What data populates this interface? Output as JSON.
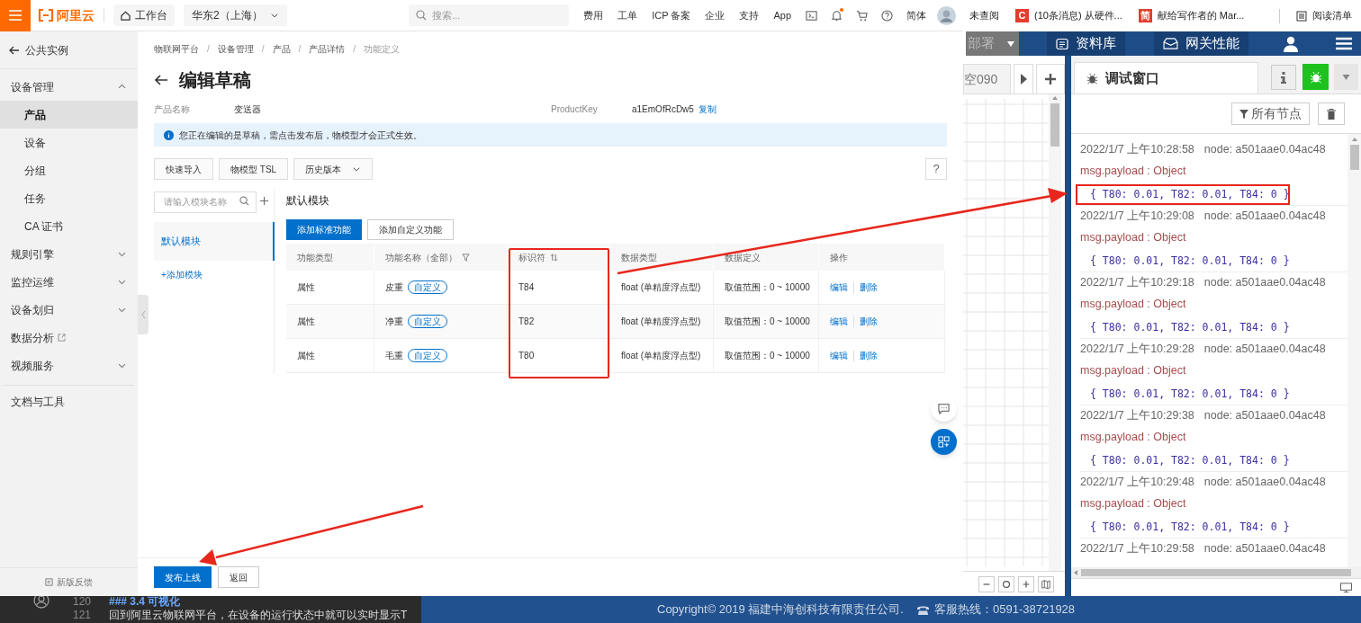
{
  "topbar": {
    "logo": "阿里云",
    "workbench": "工作台",
    "region": "华东2（上海）",
    "search_placeholder": "搜索...",
    "links": [
      "费用",
      "工单",
      "ICP 备案",
      "企业",
      "支持",
      "App"
    ],
    "notification_dot": true,
    "language": "简体"
  },
  "bookmarks": [
    {
      "kind": "plain",
      "label": "未查阅"
    },
    {
      "kind": "favicon",
      "icon_text": "C",
      "label": "(10条消息) 从硬件..."
    },
    {
      "kind": "favicon",
      "icon_text": "简",
      "label": "献给写作者的 Mar..."
    }
  ],
  "reading_list": "阅读清单",
  "sidebar": {
    "back": "公共实例",
    "items": [
      {
        "kind": "group",
        "label": "设备管理",
        "expanded": true,
        "children": [
          {
            "label": "产品",
            "selected": true
          },
          {
            "label": "设备",
            "selected": false
          },
          {
            "label": "分组",
            "selected": false
          },
          {
            "label": "任务",
            "selected": false
          },
          {
            "label": "CA 证书",
            "selected": false
          }
        ]
      },
      {
        "kind": "group",
        "label": "规则引擎",
        "expanded": false
      },
      {
        "kind": "group",
        "label": "监控运维",
        "expanded": false
      },
      {
        "kind": "group",
        "label": "设备划归",
        "expanded": false
      },
      {
        "kind": "external",
        "label": "数据分析"
      },
      {
        "kind": "group",
        "label": "视频服务",
        "expanded": false
      }
    ],
    "docs": "文档与工具",
    "feedback": "新版反馈"
  },
  "main": {
    "breadcrumbs": [
      {
        "label": "物联网平台",
        "separator": "/"
      },
      {
        "label": "设备管理",
        "separator": "/"
      },
      {
        "label": "产品",
        "separator": "/"
      },
      {
        "label": "产品详情",
        "separator": "/"
      },
      {
        "label": "功能定义"
      }
    ],
    "title": "编辑草稿",
    "product_name_label": "产品名称",
    "product_name": "变送器",
    "product_key_label": "ProductKey",
    "product_key": "a1EmOfRcDw5",
    "copy": "复制",
    "notice": "您正在编辑的是草稿，需点击发布后，物模型才会正式生效。",
    "toolbar": [
      {
        "kind": "button",
        "label": "快速导入"
      },
      {
        "kind": "button",
        "label": "物模型 TSL"
      },
      {
        "kind": "dropdown",
        "label": "历史版本"
      }
    ],
    "help": "?",
    "module_search_placeholder": "请输入模块名称",
    "modules": [
      {
        "label": "默认模块",
        "selected": true
      }
    ],
    "add_module": "+添加模块",
    "module_title": "默认模块",
    "actions": [
      {
        "label": "添加标准功能",
        "primary": true
      },
      {
        "label": "添加自定义功能",
        "primary": false
      }
    ],
    "table": {
      "columns": [
        {
          "label": "功能类型",
          "filter": false,
          "sortable": false,
          "highlighted": false
        },
        {
          "label": "功能名称（全部）",
          "filter": true,
          "sortable": false,
          "highlighted": false
        },
        {
          "label": "标识符",
          "filter": false,
          "sortable": true,
          "highlighted": true
        },
        {
          "label": "数据类型",
          "filter": false,
          "sortable": false,
          "highlighted": false
        },
        {
          "label": "数据定义",
          "filter": false,
          "sortable": false,
          "highlighted": false
        },
        {
          "label": "操作",
          "filter": false,
          "sortable": false,
          "highlighted": false
        }
      ],
      "rows": [
        {
          "type": "属性",
          "name": "皮重",
          "tag": "自定义",
          "identifier": "T84",
          "data_type": "float (单精度浮点型)",
          "definition": "取值范围：0 ~ 10000",
          "actions": [
            "编辑",
            "删除"
          ]
        },
        {
          "type": "属性",
          "name": "净重",
          "tag": "自定义",
          "identifier": "T82",
          "data_type": "float (单精度浮点型)",
          "definition": "取值范围：0 ~ 10000",
          "actions": [
            "编辑",
            "删除"
          ]
        },
        {
          "type": "属性",
          "name": "毛重",
          "tag": "自定义",
          "identifier": "T80",
          "data_type": "float (单精度浮点型)",
          "definition": "取值范围：0 ~ 10000",
          "actions": [
            "编辑",
            "删除"
          ]
        }
      ]
    },
    "footer_buttons": [
      {
        "label": "发布上线",
        "primary": true
      },
      {
        "label": "返回",
        "primary": false
      }
    ]
  },
  "nodered": {
    "deploy": "部署",
    "nav": [
      "资料库",
      "网关性能"
    ],
    "flow_tab": "空090",
    "debug_tab": "调试窗口",
    "filter": "所有节点",
    "messages": [
      {
        "time": "2022/1/7 上午10:28:58",
        "node": "node: a501aae0.04ac48",
        "label": "msg.payload : Object",
        "payload": "{ T80: 0.01, T82: 0.01, T84: 0 }",
        "highlighted": true
      },
      {
        "time": "2022/1/7 上午10:29:08",
        "node": "node: a501aae0.04ac48",
        "label": "msg.payload : Object",
        "payload": "{ T80: 0.01, T82: 0.01, T84: 0 }",
        "highlighted": false
      },
      {
        "time": "2022/1/7 上午10:29:18",
        "node": "node: a501aae0.04ac48",
        "label": "msg.payload : Object",
        "payload": "{ T80: 0.01, T82: 0.01, T84: 0 }",
        "highlighted": false
      },
      {
        "time": "2022/1/7 上午10:29:28",
        "node": "node: a501aae0.04ac48",
        "label": "msg.payload : Object",
        "payload": "{ T80: 0.01, T82: 0.01, T84: 0 }",
        "highlighted": false
      },
      {
        "time": "2022/1/7 上午10:29:38",
        "node": "node: a501aae0.04ac48",
        "label": "msg.payload : Object",
        "payload": "{ T80: 0.01, T82: 0.01, T84: 0 }",
        "highlighted": false
      },
      {
        "time": "2022/1/7 上午10:29:48",
        "node": "node: a501aae0.04ac48",
        "label": "msg.payload : Object",
        "payload": "{ T80: 0.01, T82: 0.01, T84: 0 }",
        "highlighted": false
      },
      {
        "time": "2022/1/7 上午10:29:58",
        "node": "node: a501aae0.04ac48"
      }
    ]
  },
  "editor": [
    {
      "number": "120",
      "text": "### 3.4 可视化"
    },
    {
      "number": "121",
      "text": "回到阿里云物联网平台，在设备的运行状态中就可以实时显示T"
    }
  ],
  "footer": {
    "copyright": "Copyright© 2019 福建中海创科技有限责任公司.",
    "hotline": "客服热线：0591-38721928"
  }
}
